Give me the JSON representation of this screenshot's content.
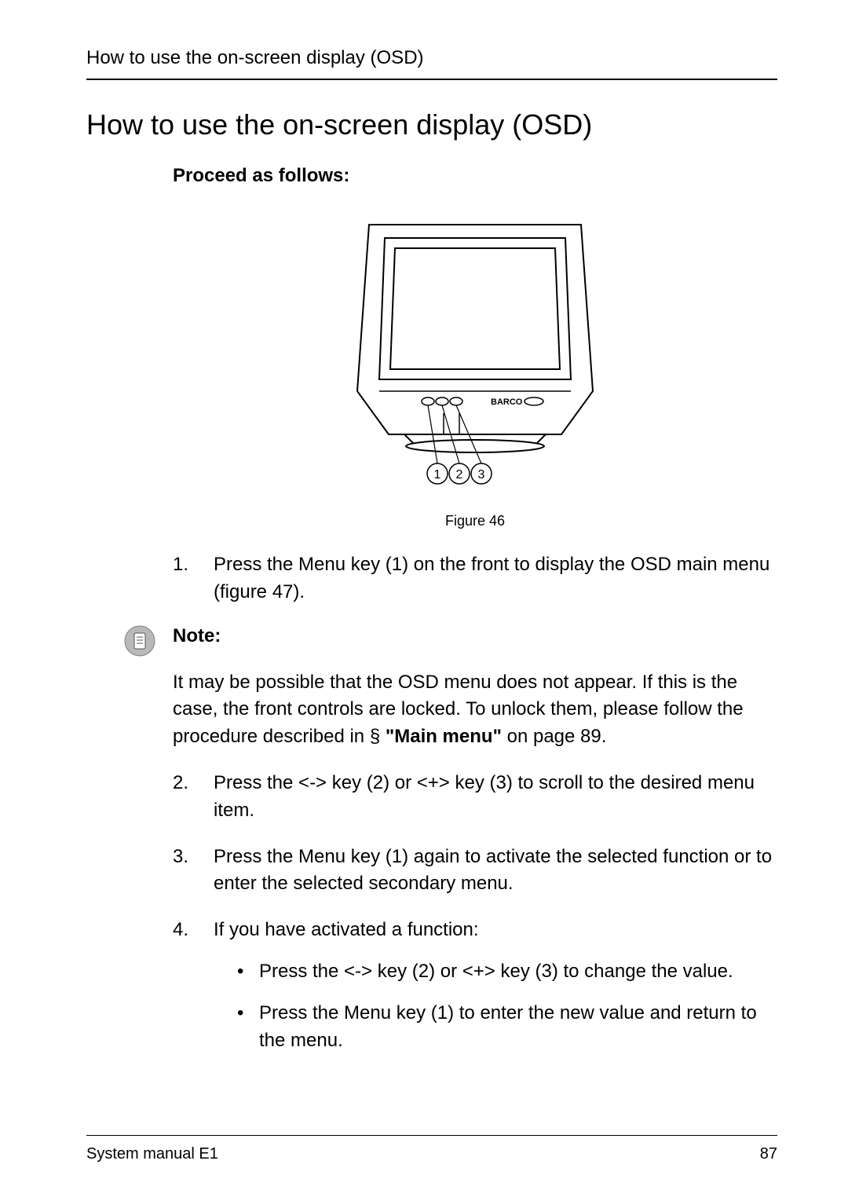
{
  "runningHead": "How to use the on-screen display (OSD)",
  "title": "How to use the on-screen display (OSD)",
  "subhead": "Proceed as follows:",
  "figure": {
    "caption": "Figure 46",
    "brand": "BARCO",
    "callouts": [
      "1",
      "2",
      "3"
    ]
  },
  "steps": {
    "s1": {
      "num": "1.",
      "text": "Press the Menu key (1) on the front to display the OSD main menu (figure 47)."
    },
    "note": {
      "label": "Note:",
      "para_a": "It may be possible that the OSD menu does not appear. If this is the case, the front controls are locked. To unlock them, please follow the procedure described in § ",
      "para_bold": "\"Main menu\"",
      "para_b": " on page 89."
    },
    "s2": {
      "num": "2.",
      "text": "Press the <-> key (2) or <+> key (3) to scroll to the desired menu item."
    },
    "s3": {
      "num": "3.",
      "text": "Press the Menu key (1) again to activate the selected function or to enter the selected secondary menu."
    },
    "s4": {
      "num": "4.",
      "text": "If you have activated a function:",
      "b1": "Press the <-> key (2) or <+> key (3) to change the value.",
      "b2": "Press the Menu key (1) to enter the new value and return to the menu."
    }
  },
  "footer": {
    "left": "System manual E1",
    "right": "87"
  }
}
